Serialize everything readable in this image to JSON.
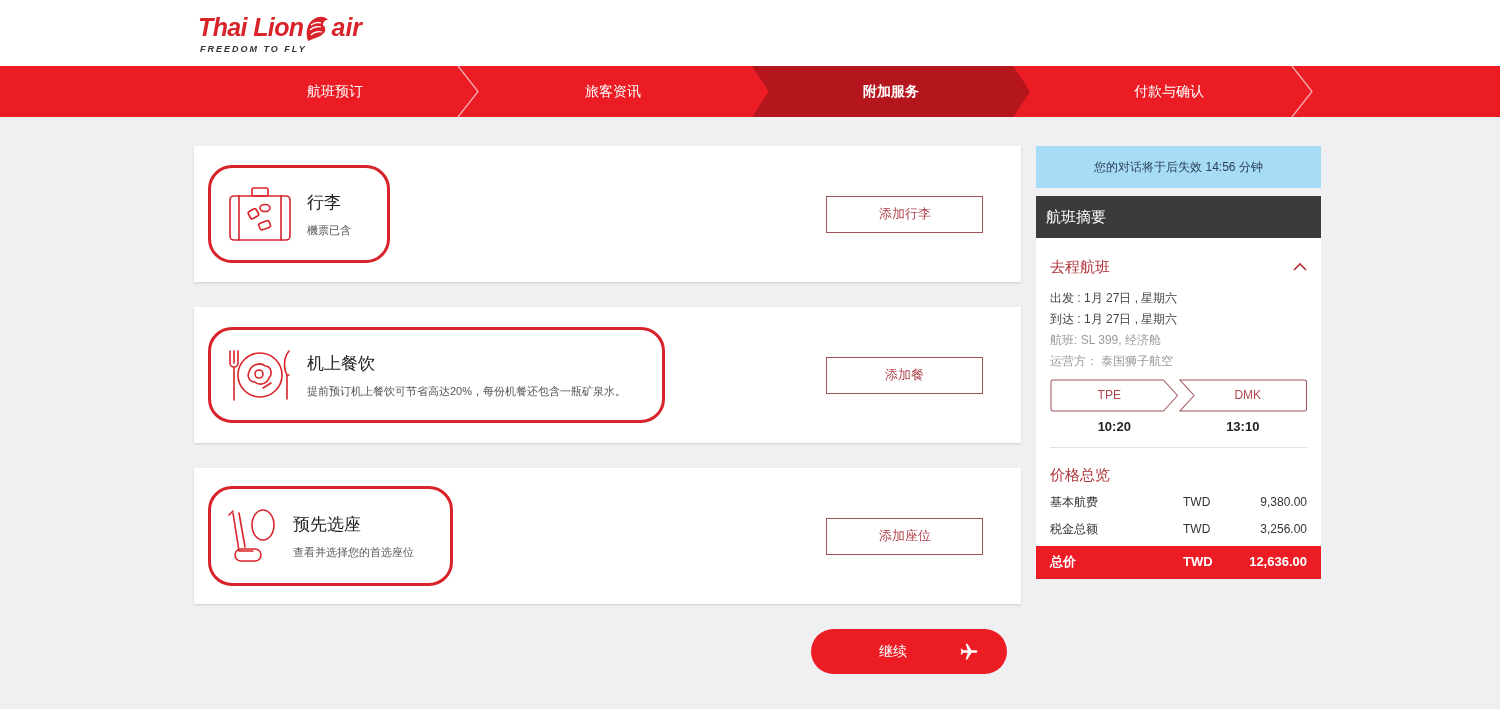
{
  "logo": {
    "brand": "Thai Lion",
    "brand_suffix": "air",
    "tagline": "FREEDOM TO FLY"
  },
  "steps": [
    {
      "label": "航班预订",
      "selected": false
    },
    {
      "label": "旅客资讯",
      "selected": false
    },
    {
      "label": "附加服务",
      "selected": true
    },
    {
      "label": "付款与确认",
      "selected": false
    }
  ],
  "services": [
    {
      "kind": "baggage",
      "title": "行李",
      "description": "機票已含",
      "button": "添加行李",
      "highlighted": true
    },
    {
      "kind": "meal",
      "title": "机上餐饮",
      "description": "提前预订机上餐饮可节省高达20%，每份机餐还包含一瓶矿泉水。",
      "button": "添加餐",
      "highlighted": true
    },
    {
      "kind": "seat",
      "title": "预先选座",
      "description": "查看并选择您的首选座位",
      "button": "添加座位",
      "highlighted": true
    }
  ],
  "continue_button": "继续",
  "session_notice": "您的对话将于后失效 14:56 分钟",
  "summary": {
    "title": "航班摘要",
    "flight_heading": "去程航班",
    "expanded": true,
    "details": [
      {
        "text": "出发 : 1月 27日 , 星期六",
        "kind": "primary"
      },
      {
        "text": "到达 : 1月 27日 , 星期六",
        "kind": "primary"
      },
      {
        "text": "航班: SL 399, 经济舱",
        "kind": "secondary"
      },
      {
        "text": "运营方： 泰国狮子航空",
        "kind": "secondary"
      }
    ],
    "origin": {
      "code": "TPE",
      "time": "10:20"
    },
    "destination": {
      "code": "DMK",
      "time": "13:10"
    },
    "price_heading": "价格总览",
    "prices": [
      {
        "label": "基本航费",
        "currency": "TWD",
        "amount": "9,380.00"
      },
      {
        "label": "税金总额",
        "currency": "TWD",
        "amount": "3,256.00"
      }
    ],
    "total": {
      "label": "总价",
      "currency": "TWD",
      "amount": "12,636.00"
    }
  }
}
